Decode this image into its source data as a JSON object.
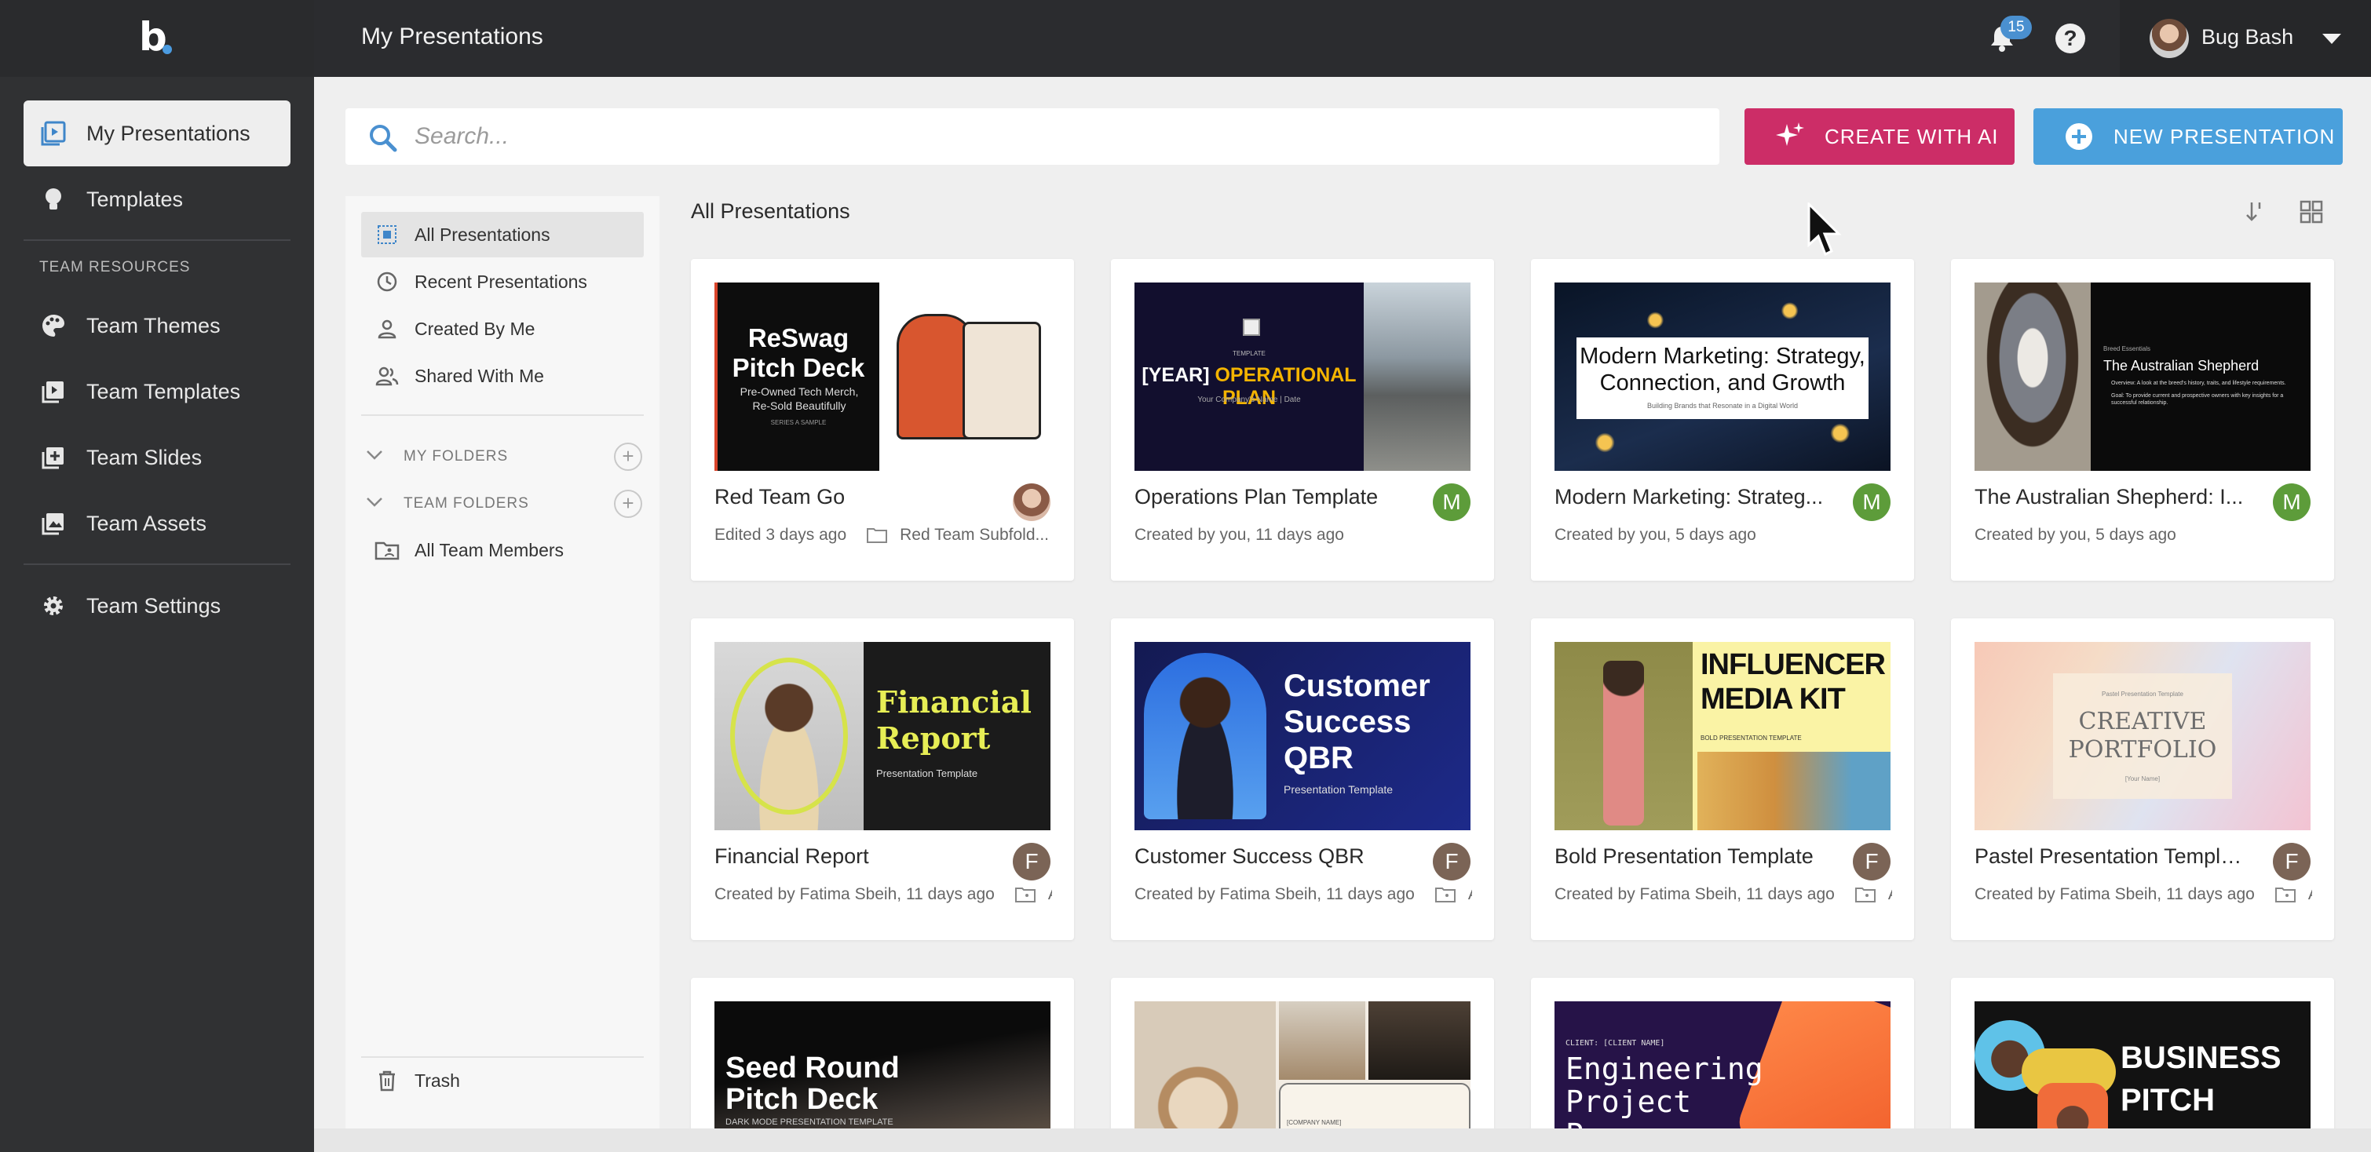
{
  "app": {
    "logo": "b",
    "page_title": "My Presentations"
  },
  "topbar": {
    "notification_count": "15",
    "help_label": "?",
    "user_name": "Bug Bash"
  },
  "sidebar": {
    "main_items": [
      {
        "label": "My Presentations",
        "icon": "presentation-icon",
        "active": true
      },
      {
        "label": "Templates",
        "icon": "lightbulb-icon",
        "active": false
      }
    ],
    "team_heading": "TEAM RESOURCES",
    "team_items": [
      {
        "label": "Team Themes",
        "icon": "palette-icon"
      },
      {
        "label": "Team Templates",
        "icon": "template-icon"
      },
      {
        "label": "Team Slides",
        "icon": "slides-icon"
      },
      {
        "label": "Team Assets",
        "icon": "image-icon"
      }
    ],
    "settings_label": "Team Settings"
  },
  "search": {
    "placeholder": "Search..."
  },
  "actions": {
    "create_ai": "CREATE WITH AI",
    "new_presentation": "NEW PRESENTATION"
  },
  "folders": {
    "views": [
      {
        "label": "All Presentations",
        "active": true
      },
      {
        "label": "Recent Presentations"
      },
      {
        "label": "Created By Me"
      },
      {
        "label": "Shared With Me"
      }
    ],
    "my_folders": "MY FOLDERS",
    "team_folders": "TEAM FOLDERS",
    "team_folder_items": [
      "All Team Members"
    ],
    "trash": "Trash"
  },
  "main": {
    "section_title": "All Presentations",
    "cards": [
      {
        "title": "Red Team Go",
        "meta": "Edited 3 days ago",
        "folder": "Red Team Subfold...",
        "avatar": "",
        "avatar_color": "#c9a58f",
        "thumb": {
          "line1": "ReSwag",
          "line2": "Pitch Deck",
          "sub": "Pre-Owned Tech Merch, Re-Sold Beautifully",
          "tiny": "SERIES A SAMPLE"
        }
      },
      {
        "title": "Operations Plan Template",
        "meta": "Created by you, 11 days ago",
        "folder": "",
        "avatar": "M",
        "avatar_color": "#5d9c3a",
        "thumb": {
          "line0": "TEMPLATE",
          "line1a": "[YEAR]",
          "line1b": "OPERATIONAL PLAN",
          "sub": "Your Company's Name | Date"
        }
      },
      {
        "title": "Modern Marketing: Strateg...",
        "meta": "Created by you, 5 days ago",
        "folder": "",
        "avatar": "M",
        "avatar_color": "#5d9c3a",
        "thumb": {
          "line1": "Modern Marketing: Strategy,",
          "line2": "Connection, and Growth",
          "sub": "Building Brands that Resonate in a Digital World"
        }
      },
      {
        "title": "The Australian Shepherd: I...",
        "meta": "Created by you, 5 days ago",
        "folder": "",
        "avatar": "M",
        "avatar_color": "#5d9c3a",
        "thumb": {
          "line0": "Breed Essentials",
          "line1": "The Australian Shepherd",
          "bullet1": "Overview: A look at the breed's history, traits, and lifestyle requirements.",
          "bullet2": "Goal: To provide current and prospective owners with key insights for a successful relationship."
        }
      },
      {
        "title": "Financial Report",
        "meta": "Created by Fatima Sbeih, 11 days ago",
        "folder": "A",
        "avatar": "F",
        "avatar_color": "#7b6456",
        "thumb": {
          "line1": "Financial",
          "line2": "Report",
          "sub": "Presentation Template"
        }
      },
      {
        "title": "Customer Success QBR",
        "meta": "Created by Fatima Sbeih, 11 days ago",
        "folder": "A",
        "avatar": "F",
        "avatar_color": "#7b6456",
        "thumb": {
          "line1": "Customer",
          "line2": "Success",
          "line3": "QBR",
          "sub": "Presentation Template"
        }
      },
      {
        "title": "Bold Presentation Template",
        "meta": "Created by Fatima Sbeih, 11 days ago",
        "folder": "A",
        "avatar": "F",
        "avatar_color": "#7b6456",
        "thumb": {
          "line1": "INFLUENCER",
          "line2": "MEDIA KIT",
          "sub": "BOLD PRESENTATION TEMPLATE"
        }
      },
      {
        "title": "Pastel Presentation Template",
        "meta": "Created by Fatima Sbeih, 11 days ago",
        "folder": "A",
        "avatar": "F",
        "avatar_color": "#7b6456",
        "thumb": {
          "line0": "Pastel Presentation Template",
          "line1": "CREATIVE",
          "line2": "PORTFOLIO",
          "sub": "[Your Name]"
        }
      },
      {
        "title": "",
        "meta": "",
        "folder": "",
        "avatar": "",
        "avatar_color": "",
        "thumb": {
          "line1": "Seed Round",
          "line2": "Pitch Deck",
          "sub": "DARK MODE PRESENTATION TEMPLATE"
        }
      },
      {
        "title": "",
        "meta": "",
        "folder": "",
        "avatar": "",
        "avatar_color": "",
        "thumb": {
          "sub": "[COMPANY NAME]"
        }
      },
      {
        "title": "",
        "meta": "",
        "folder": "",
        "avatar": "",
        "avatar_color": "",
        "thumb": {
          "line0": "CLIENT: [CLIENT NAME]",
          "line1": "Engineering",
          "line2": "Project",
          "line3": "P..."
        }
      },
      {
        "title": "",
        "meta": "",
        "folder": "",
        "avatar": "",
        "avatar_color": "",
        "thumb": {
          "line1": "BUSINESS",
          "line2": "PITCH"
        }
      }
    ]
  }
}
